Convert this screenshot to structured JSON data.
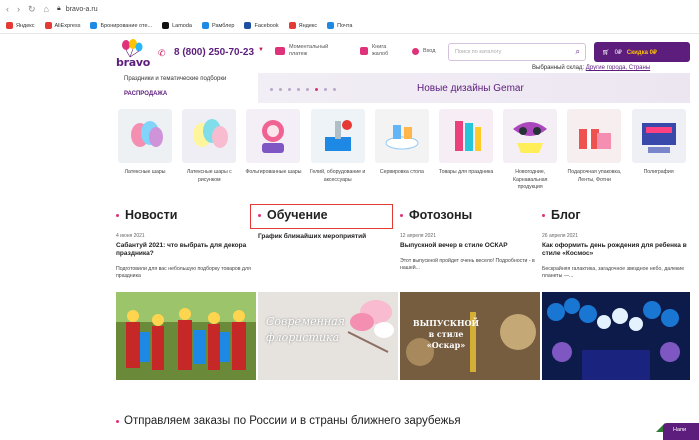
{
  "browser": {
    "url": "bravo-a.ru"
  },
  "bookmarks": [
    {
      "label": "Яндекс",
      "color": "#e53935"
    },
    {
      "label": "AliExpress",
      "color": "#e53935"
    },
    {
      "label": "Бронирование оте...",
      "color": "#1e88e5"
    },
    {
      "label": "Lamoda",
      "color": "#111111"
    },
    {
      "label": "Рамблер",
      "color": "#1e88e5"
    },
    {
      "label": "Facebook",
      "color": "#1e4fa3"
    },
    {
      "label": "Яндекс",
      "color": "#e53935"
    },
    {
      "label": "Почта",
      "color": "#1e88e5"
    }
  ],
  "header": {
    "logo_text": "bravo",
    "phone": "8 (800) 250-70-23",
    "instant_payment": "Моментальный платеж",
    "book_notes": "Книга жалоб",
    "login": "Вход",
    "search_placeholder": "Поиск по каталогу",
    "cart_count": "0₽",
    "cart_sum": "Скидка 0₽",
    "warehouse_label": "Выбранный склад:",
    "warehouse_link": "Другие города, Страны"
  },
  "menu": {
    "item1": "Праздники и тематические подборки",
    "item2": "РАСПРОДАЖА"
  },
  "banner": {
    "title": "Новые дизайны Gemar"
  },
  "categories": [
    {
      "label": "Латексные шары"
    },
    {
      "label": "Латексные шары с рисунком"
    },
    {
      "label": "Фольгированные шары"
    },
    {
      "label": "Гелий, оборудование и аксессуары"
    },
    {
      "label": "Сервировка стола"
    },
    {
      "label": "Товары для праздника"
    },
    {
      "label": "Новогодние, Карнавальная продукция"
    },
    {
      "label": "Подарочная упаковка, Ленты, Фотни"
    },
    {
      "label": "Полиграфия"
    }
  ],
  "news": [
    {
      "head": "Новости",
      "date": "4 июня 2021",
      "title": "Сабантуй 2021: что выбрать для декора праздника?",
      "text": "Подготовили для вас небольшую подборку товаров для праздника"
    },
    {
      "head": "Обучение",
      "date": "",
      "title": "График ближайших мероприятий",
      "text": ""
    },
    {
      "head": "Фотозоны",
      "date": "12 апреля 2021",
      "title": "Выпускной вечер в стиле ОСКАР",
      "text": "Этот выпускной пройдет очень весело! Подробности - в нашей..."
    },
    {
      "head": "Блог",
      "date": "26 апреля 2021",
      "title": "Как оформить день рождения для ребенка в стиле «Космос»",
      "text": "Бескрайняя галактика, загадочное звездное небо, далекие планеты —..."
    }
  ],
  "photo_captions": {
    "education": "Современная флористика",
    "photozone": "ВЫПУСКНОЙ в стиле «Оскар»"
  },
  "bottom": {
    "title": "Отправляем заказы по России и в страны ближнего зарубежья"
  },
  "chat": {
    "label": "Напи"
  }
}
